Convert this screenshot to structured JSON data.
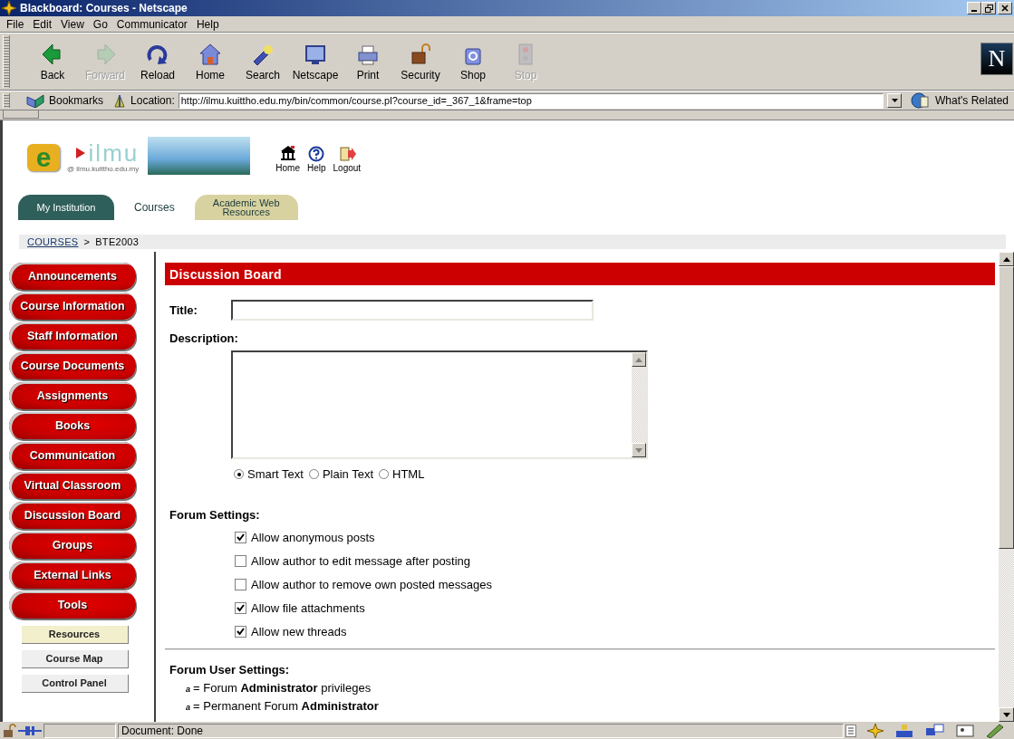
{
  "window": {
    "title": "Blackboard: Courses - Netscape"
  },
  "menu": [
    "File",
    "Edit",
    "View",
    "Go",
    "Communicator",
    "Help"
  ],
  "toolbar": [
    {
      "label": "Back",
      "disabled": false
    },
    {
      "label": "Forward",
      "disabled": true
    },
    {
      "label": "Reload",
      "disabled": false
    },
    {
      "label": "Home",
      "disabled": false
    },
    {
      "label": "Search",
      "disabled": false
    },
    {
      "label": "Netscape",
      "disabled": false
    },
    {
      "label": "Print",
      "disabled": false
    },
    {
      "label": "Security",
      "disabled": false
    },
    {
      "label": "Shop",
      "disabled": false
    },
    {
      "label": "Stop",
      "disabled": true
    }
  ],
  "brand_logo": {
    "letter": "N"
  },
  "location_bar": {
    "bookmarks": "Bookmarks",
    "location_label": "Location:",
    "url": "http://ilmu.kuittho.edu.my/bin/common/course.pl?course_id=_367_1&frame=top",
    "whats_related": "What's Related"
  },
  "site": {
    "logo": {
      "letter": "e",
      "name": "ilmu",
      "tagline": "@ ilmu.kuittho.edu.my"
    },
    "nav_links": [
      "Home",
      "Help",
      "Logout"
    ],
    "tabs": [
      {
        "label": "My Institution",
        "selected": false,
        "color": "#2f5f5a"
      },
      {
        "label": "Courses",
        "selected": true
      },
      {
        "label": "Academic Web Resources",
        "selected": false,
        "color": "#d8d2a0"
      }
    ],
    "breadcrumb": {
      "link": "COURSES",
      "separator": ">",
      "current": "BTE2003"
    }
  },
  "sidebar": {
    "buttons": [
      "Announcements",
      "Course Information",
      "Staff Information",
      "Course Documents",
      "Assignments",
      "Books",
      "Communication",
      "Virtual Classroom",
      "Discussion Board",
      "Groups",
      "External Links",
      "Tools"
    ],
    "sub_buttons": [
      {
        "label": "Resources",
        "selected": true
      },
      {
        "label": "Course Map",
        "selected": false
      },
      {
        "label": "Control Panel",
        "selected": false
      }
    ]
  },
  "main": {
    "heading": "Discussion Board",
    "title_label": "Title:",
    "description_label": "Description:",
    "text_formats": [
      {
        "label": "Smart Text",
        "selected": true
      },
      {
        "label": "Plain Text",
        "selected": false
      },
      {
        "label": "HTML",
        "selected": false
      }
    ],
    "forum_settings_label": "Forum Settings:",
    "settings": [
      {
        "label": "Allow anonymous posts",
        "checked": true
      },
      {
        "label": "Allow author to edit message after posting",
        "checked": false
      },
      {
        "label": "Allow author to remove own posted messages",
        "checked": false
      },
      {
        "label": "Allow file attachments",
        "checked": true
      },
      {
        "label": "Allow new threads",
        "checked": true
      }
    ],
    "user_settings_label": "Forum User Settings:",
    "user_settings": [
      {
        "marker": "a",
        "text": "= Forum **Administrator** privileges"
      },
      {
        "marker": "a",
        "text": "= Permanent Forum **Administrator**"
      }
    ]
  },
  "status_bar": {
    "text": "Document: Done"
  }
}
